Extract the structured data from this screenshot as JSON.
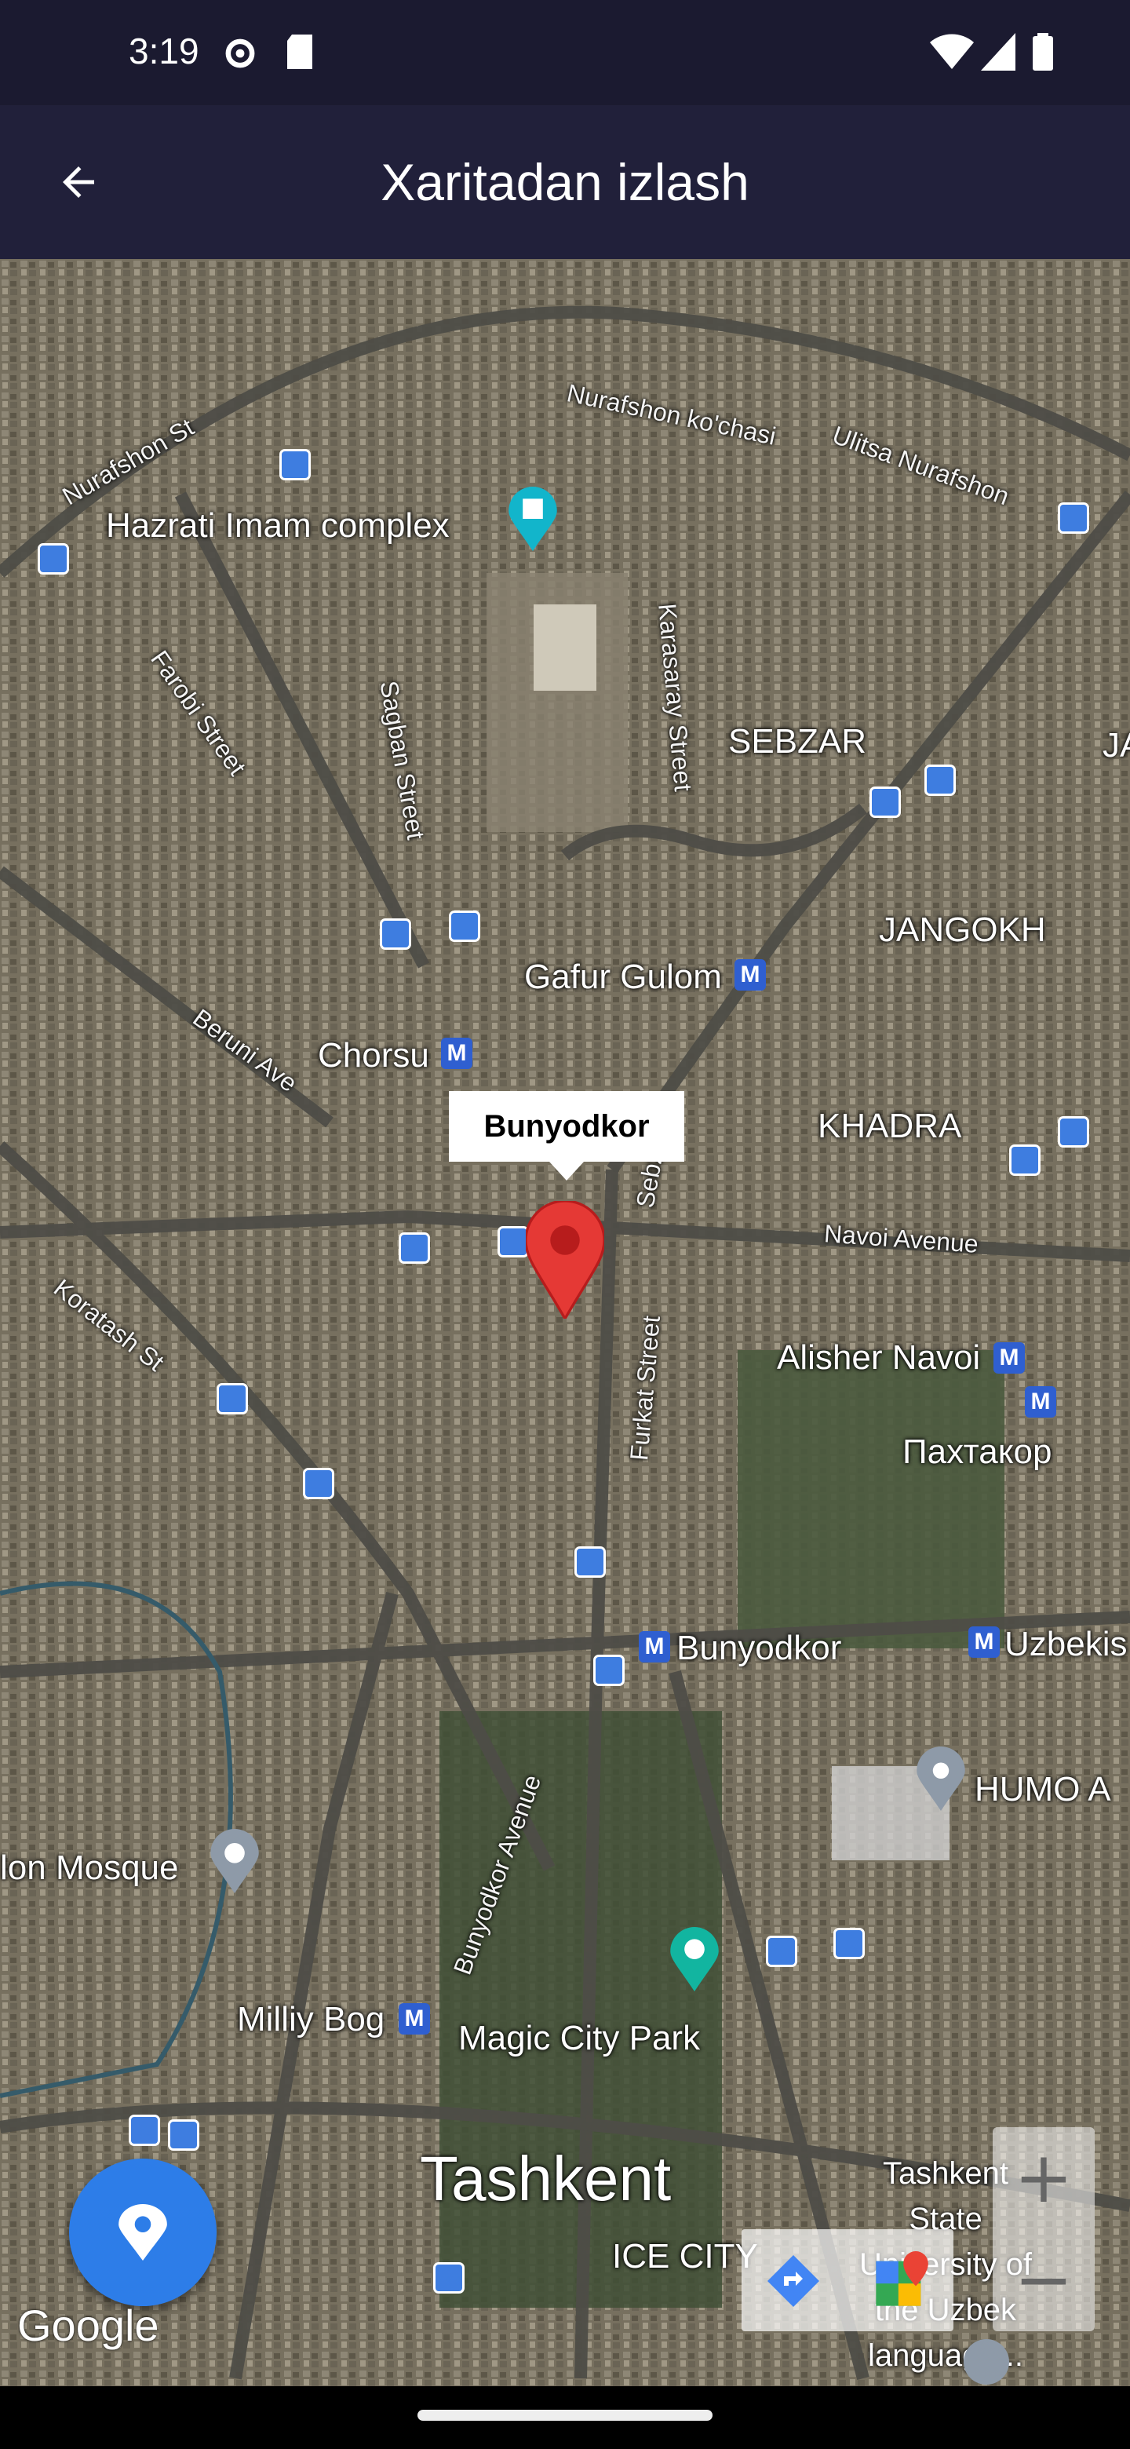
{
  "status": {
    "time": "3:19"
  },
  "appbar": {
    "title": "Xaritadan izlash"
  },
  "map": {
    "marker_title": "Bunyodkor",
    "labels": {
      "hazrati": "Hazrati Imam complex",
      "sebzar": "SEBZAR",
      "jangokh": "JANGOKH",
      "gafur": "Gafur Gulom",
      "chorsu": "Chorsu",
      "khadra": "KHADRA",
      "alisher": "Alisher Navoi",
      "paxtakor": "Пахтакор",
      "bunyodkor": "Bunyodkor",
      "uzbekis": "Uzbekis",
      "humo": "HUMO A",
      "mosque": "lon Mosque",
      "milliy": "Milliy Bog",
      "magic": "Magic City Park",
      "tashkent": "Tashkent",
      "icecity": "ICE CITY",
      "tsu": "Tashkent State University of the Uzbek language...",
      "ja": "JA"
    },
    "streets": {
      "nurafshon_kochasi": "Nurafshon ko'chasi",
      "ulitsa": "Ulitsa Nurafshon",
      "nurafshon_st": "Nurafshon St",
      "farobi": "Farobi Street",
      "sagban": "Sagban Street",
      "karasaray": "Karasaray Street",
      "beruni": "Beruni Ave",
      "koratash": "Koratash St",
      "navoi": "Navoi Avenue",
      "furkat": "Furkat Street",
      "sebzor": "Sebzor",
      "bunyodkor_ave": "Bunyodkor Avenue"
    },
    "zoom_in": "+",
    "zoom_out": "−",
    "attribution": "Google",
    "icons": [
      "bus-stop-icon",
      "metro-icon",
      "monument-icon",
      "mosque-icon",
      "park-icon",
      "location-pin-icon",
      "directions-icon",
      "google-maps-icon",
      "school-icon"
    ]
  },
  "fab": {
    "icon": "location-pin-icon",
    "color": "#2d7de8"
  },
  "colors": {
    "statusbar": "#1b1a30",
    "appbar": "#21203a",
    "marker": "#e53935"
  }
}
